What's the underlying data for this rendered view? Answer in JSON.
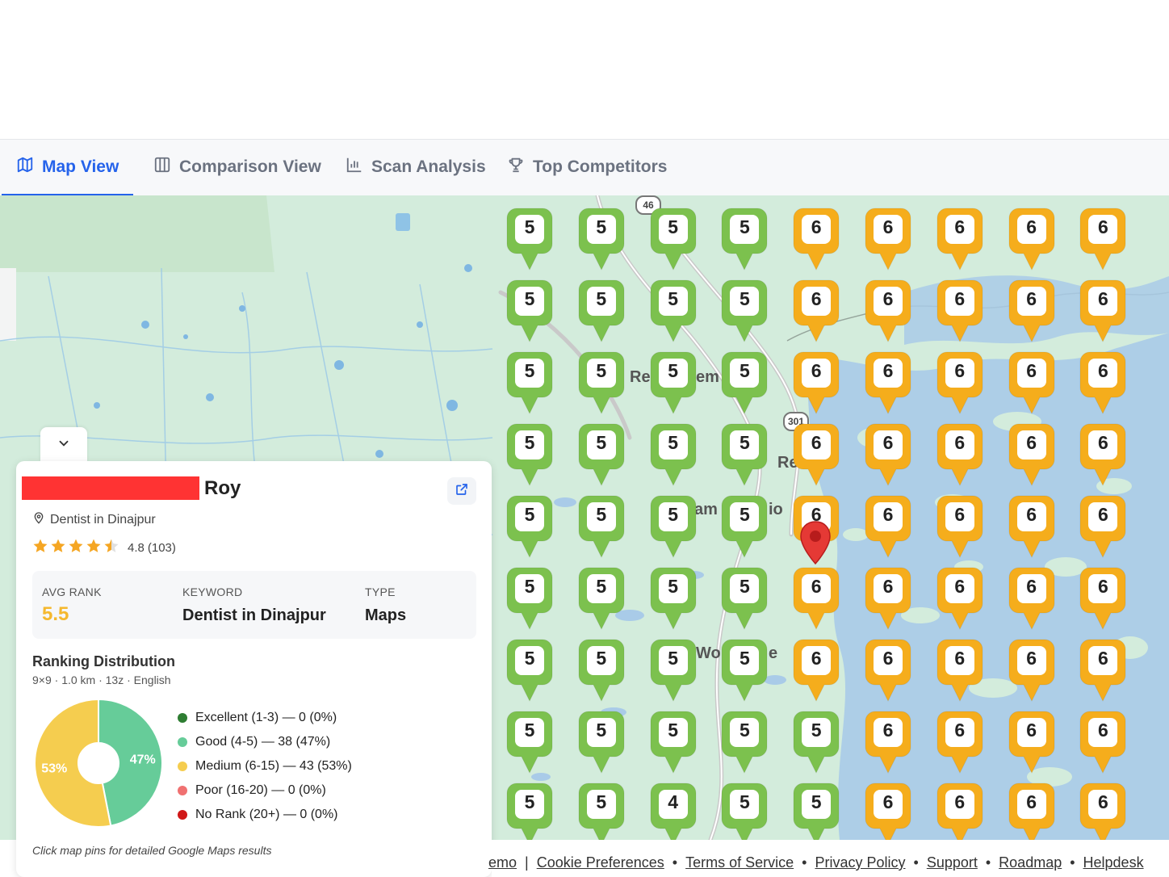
{
  "tabs": [
    {
      "label": "Map View",
      "icon": "map-icon",
      "active": true
    },
    {
      "label": "Comparison View",
      "icon": "columns-icon",
      "active": false
    },
    {
      "label": "Scan Analysis",
      "icon": "bar-chart-icon",
      "active": false
    },
    {
      "label": "Top Competitors",
      "icon": "trophy-icon",
      "active": false
    }
  ],
  "map": {
    "grid": [
      [
        5,
        5,
        5,
        5,
        6,
        6,
        6,
        6,
        6
      ],
      [
        5,
        5,
        5,
        5,
        6,
        6,
        6,
        6,
        6
      ],
      [
        5,
        5,
        5,
        5,
        6,
        6,
        6,
        6,
        6
      ],
      [
        5,
        5,
        5,
        5,
        6,
        6,
        6,
        6,
        6
      ],
      [
        5,
        5,
        5,
        5,
        6,
        6,
        6,
        6,
        6
      ],
      [
        5,
        5,
        5,
        5,
        6,
        6,
        6,
        6,
        6
      ],
      [
        5,
        5,
        5,
        5,
        6,
        6,
        6,
        6,
        6
      ],
      [
        5,
        5,
        5,
        5,
        5,
        6,
        6,
        6,
        6
      ],
      [
        5,
        5,
        4,
        5,
        5,
        6,
        6,
        6,
        6
      ]
    ],
    "labels": [
      "Re",
      "em",
      "Re",
      "am",
      "io",
      "Wo",
      "e"
    ],
    "road_shields": [
      "46",
      "301"
    ],
    "colors": {
      "good": "#7cc14e",
      "medium": "#f5ad1c",
      "water": "#a9cbe8",
      "land": "#d3ecdc"
    }
  },
  "business": {
    "name_suffix": "Roy",
    "category": "Dentist in Dinajpur",
    "rating": "4.8",
    "reviews": "(103)",
    "rating_stars": 4.5
  },
  "stats": {
    "avg_rank_label": "AVG RANK",
    "avg_rank": "5.5",
    "keyword_label": "KEYWORD",
    "keyword": "Dentist in Dinajpur",
    "type_label": "TYPE",
    "type": "Maps"
  },
  "distribution": {
    "title": "Ranking Distribution",
    "subtitle": "9×9 · 1.0 km · 13z · English",
    "slices": [
      {
        "label": "Excellent (1-3) — 0 (0%)",
        "count": 0,
        "color": "#2e7d32"
      },
      {
        "label": "Good (4-5) — 38 (47%)",
        "count": 38,
        "color": "#66cc99",
        "pct_label": "47%"
      },
      {
        "label": "Medium (6-15) — 43 (53%)",
        "count": 43,
        "color": "#f5cd4f",
        "pct_label": "53%"
      },
      {
        "label": "Poor (16-20) — 0 (0%)",
        "count": 0,
        "color": "#f07171"
      },
      {
        "label": "No Rank (20+) — 0 (0%)",
        "count": 0,
        "color": "#d01818"
      }
    ],
    "hint": "Click map pins for detailed Google Maps results"
  },
  "footer": {
    "links": [
      "emo",
      "Cookie Preferences",
      "Terms of Service",
      "Privacy Policy",
      "Support",
      "Roadmap",
      "Helpdesk"
    ]
  }
}
